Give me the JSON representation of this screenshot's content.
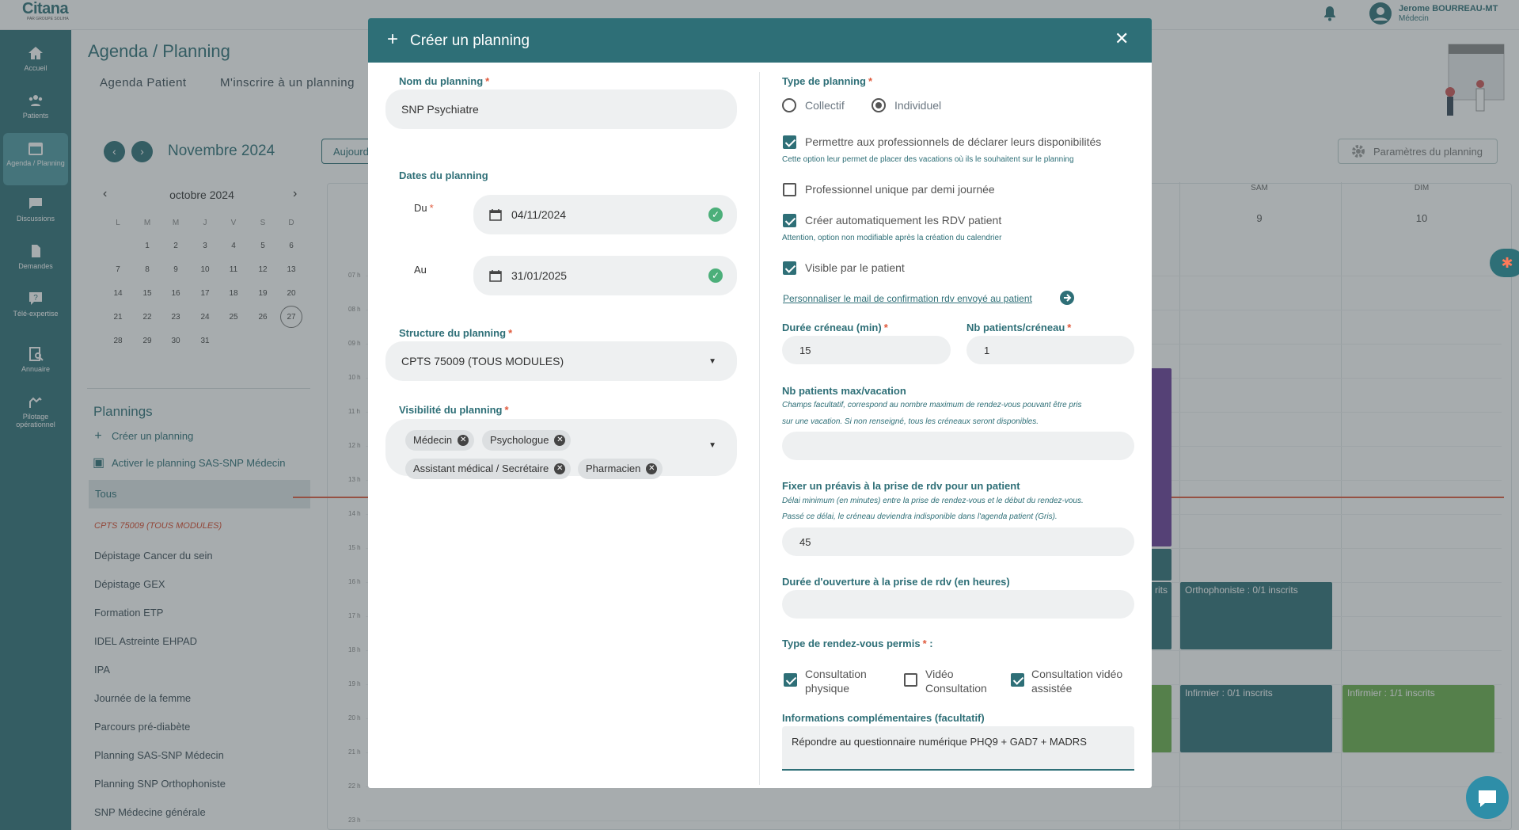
{
  "topbar": {
    "logo": "Citana",
    "logo_sub": "PAR GROUPE SOLIHA",
    "user_name": "Jerome BOURREAU-MT",
    "user_role": "Médecin"
  },
  "sidebar": {
    "items": [
      {
        "label": "Accueil",
        "icon": "home-icon"
      },
      {
        "label": "Patients",
        "icon": "users-icon"
      },
      {
        "label": "Agenda / Planning",
        "icon": "calendar-icon",
        "active": true
      },
      {
        "label": "Discussions",
        "icon": "chat-icon"
      },
      {
        "label": "Demandes",
        "icon": "document-icon"
      },
      {
        "label": "Télé-expertise",
        "icon": "question-icon"
      },
      {
        "label": "Annuaire",
        "icon": "directory-icon"
      },
      {
        "label": "Pilotage opérationnel",
        "icon": "pilotage-icon"
      }
    ]
  },
  "main": {
    "title": "Agenda / Planning",
    "tabs": [
      "Agenda Patient",
      "M'inscrire à un planning"
    ],
    "month_label": "Novembre 2024",
    "today_label": "Aujourd'hui",
    "params_label": "Paramètres du planning"
  },
  "mini_calendar": {
    "month": "octobre 2024",
    "dow": [
      "L",
      "M",
      "M",
      "J",
      "V",
      "S",
      "D"
    ],
    "weeks": [
      [
        "",
        "1",
        "2",
        "3",
        "4",
        "5",
        "6"
      ],
      [
        "7",
        "8",
        "9",
        "10",
        "11",
        "12",
        "13"
      ],
      [
        "14",
        "15",
        "16",
        "17",
        "18",
        "19",
        "20"
      ],
      [
        "21",
        "22",
        "23",
        "24",
        "25",
        "26",
        "27"
      ],
      [
        "28",
        "29",
        "30",
        "31",
        "",
        "",
        ""
      ]
    ],
    "highlighted": "27"
  },
  "plannings": {
    "title": "Plannings",
    "create_label": "Créer un planning",
    "activate_label": "Activer le planning SAS-SNP Médecin",
    "all_label": "Tous",
    "items": [
      "CPTS 75009 (TOUS MODULES)",
      "Dépistage Cancer du sein",
      "Dépistage GEX",
      "Formation ETP",
      "IDEL Astreinte EHPAD",
      "IPA",
      "Journée de la femme",
      "Parcours pré-diabète",
      "Planning SAS-SNP Médecin",
      "Planning SNP Orthophoniste",
      "SNP Médecine générale"
    ]
  },
  "calendar": {
    "days": [
      {
        "name": "SAM",
        "num": "9"
      },
      {
        "name": "DIM",
        "num": "10"
      }
    ],
    "hours": [
      "07 h",
      "08 h",
      "09 h",
      "10 h",
      "11 h",
      "12 h",
      "13 h",
      "14 h",
      "15 h",
      "16 h",
      "17 h",
      "18 h",
      "19 h",
      "20 h",
      "21 h",
      "22 h",
      "23 h"
    ],
    "events": [
      {
        "label": "rits"
      },
      {
        "label": "Orthophoniste : 0/1 inscrits"
      },
      {
        "label": "Infirmier : 0/1 inscrits"
      },
      {
        "label": "Infirmier : 1/1 inscrits"
      }
    ]
  },
  "modal": {
    "title": "Créer un planning",
    "nom_label": "Nom du planning",
    "nom_value": "SNP Psychiatre",
    "dates_label": "Dates du planning",
    "du_label": "Du",
    "du_value": "04/11/2024",
    "au_label": "Au",
    "au_value": "31/01/2025",
    "structure_label": "Structure du planning",
    "structure_value": "CPTS 75009 (TOUS MODULES)",
    "visibilite_label": "Visibilité du planning",
    "visibilite_chips": [
      "Médecin",
      "Psychologue",
      "Assistant médical / Secrétaire",
      "Pharmacien"
    ],
    "type_label": "Type de planning",
    "type_options": [
      "Collectif",
      "Individuel"
    ],
    "type_selected": "Individuel",
    "opt_dispo_label": "Permettre aux professionnels de déclarer leurs disponibilités",
    "opt_dispo_hint": "Cette option leur permet de placer des vacations où ils le souhaitent sur le planning",
    "opt_unique_label": "Professionnel unique par demi journée",
    "opt_rdv_label": "Créer automatiquement les RDV patient",
    "opt_rdv_hint": "Attention, option non modifiable après la création du calendrier",
    "opt_visible_label": "Visible par le patient",
    "mail_link": "Personnaliser le mail de confirmation rdv envoyé au patient",
    "duree_label": "Durée créneau (min)",
    "duree_value": "15",
    "nb_label": "Nb patients/créneau",
    "nb_value": "1",
    "max_label": "Nb patients max/vacation",
    "max_hint_1": "Champs facultatif, correspond au nombre maximum de rendez-vous pouvant être pris",
    "max_hint_2": "sur une vacation. Si non renseigné, tous les créneaux seront disponibles.",
    "max_value": "",
    "preavis_label": "Fixer un préavis à la prise de rdv pour un patient",
    "preavis_hint_1": "Délai minimum (en minutes) entre la prise de rendez-vous et le début du rendez-vous.",
    "preavis_hint_2": "Passé ce délai, le créneau deviendra indisponible dans l'agenda patient (Gris).",
    "preavis_value": "45",
    "ouverture_label": "Durée d'ouverture à la prise de rdv (en heures)",
    "ouverture_value": "",
    "rdv_type_label": "Type de rendez-vous permis",
    "rdv_types": [
      "Consultation physique",
      "Vidéo Consultation",
      "Consultation vidéo assistée"
    ],
    "info_label": "Informations complémentaires (facultatif)",
    "info_value": "Répondre au questionnaire numérique PHQ9 + GAD7 + MADRS"
  },
  "colors": {
    "primary": "#2e6f77",
    "required": "#e05a3d",
    "event_teal": "#2e6f77",
    "event_green": "#6ab04c",
    "event_purple": "#6a3d9a"
  }
}
